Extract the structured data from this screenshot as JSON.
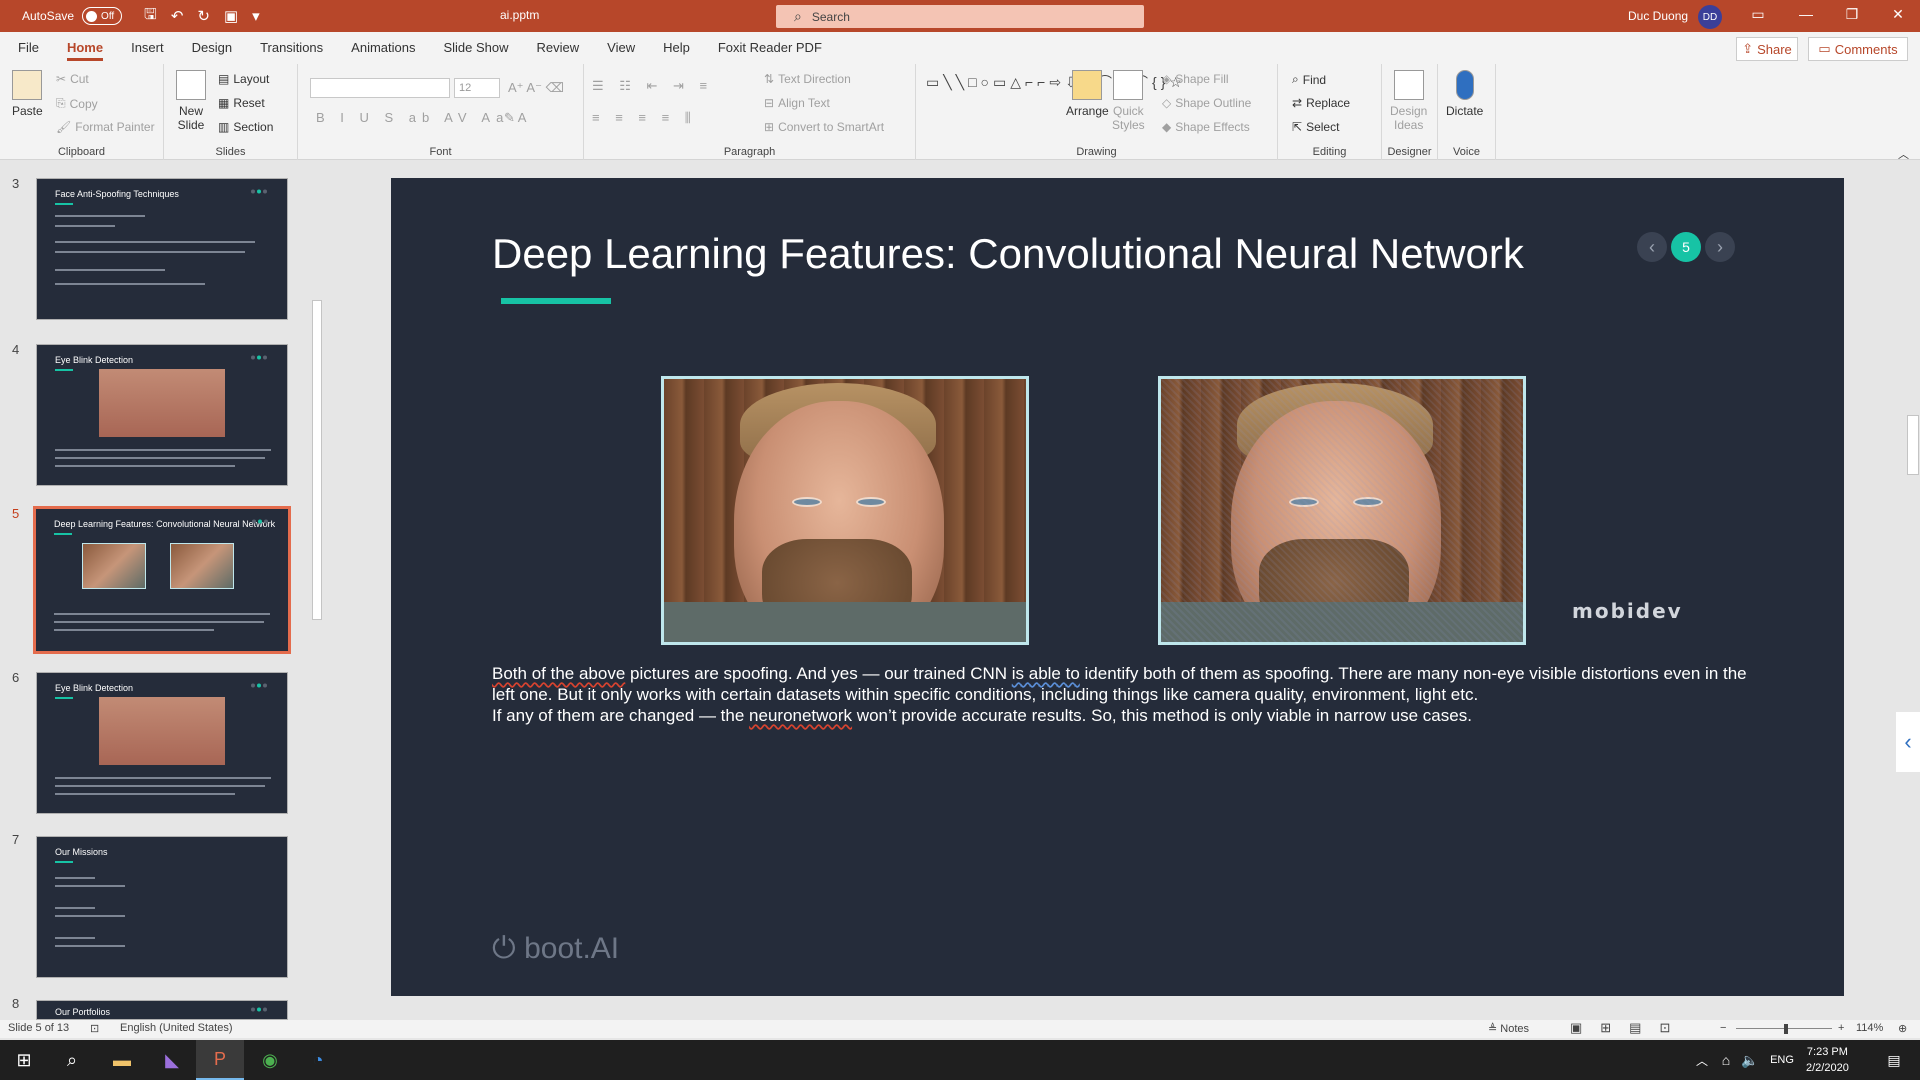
{
  "titlebar": {
    "autosave_label": "AutoSave",
    "autosave_state": "Off",
    "doc_title": "ai.pptm",
    "search_placeholder": "Search",
    "user_name": "Duc Duong",
    "user_initials": "DD"
  },
  "tabs": [
    "File",
    "Home",
    "Insert",
    "Design",
    "Transitions",
    "Animations",
    "Slide Show",
    "Review",
    "View",
    "Help",
    "Foxit Reader PDF"
  ],
  "active_tab": "Home",
  "share_label": "Share",
  "comments_label": "Comments",
  "ribbon": {
    "clipboard": {
      "paste": "Paste",
      "cut": "Cut",
      "copy": "Copy",
      "format_painter": "Format Painter",
      "label": "Clipboard"
    },
    "slides": {
      "new_slide_1": "New",
      "new_slide_2": "Slide",
      "layout": "Layout",
      "reset": "Reset",
      "section": "Section",
      "label": "Slides"
    },
    "font": {
      "size": "12",
      "label": "Font"
    },
    "paragraph": {
      "text_direction": "Text Direction",
      "align_text": "Align Text",
      "convert": "Convert to SmartArt",
      "label": "Paragraph"
    },
    "drawing": {
      "arrange": "Arrange",
      "quick_styles_1": "Quick",
      "quick_styles_2": "Styles",
      "shape_fill": "Shape Fill",
      "shape_outline": "Shape Outline",
      "shape_effects": "Shape Effects",
      "label": "Drawing"
    },
    "editing": {
      "find": "Find",
      "replace": "Replace",
      "select": "Select",
      "label": "Editing"
    },
    "designer": {
      "design_ideas_1": "Design",
      "design_ideas_2": "Ideas",
      "label": "Designer"
    },
    "voice": {
      "dictate": "Dictate",
      "label": "Voice"
    }
  },
  "thumbnails": [
    {
      "num": "3",
      "title": "Face Anti-Spoofing Techniques"
    },
    {
      "num": "4",
      "title": "Eye Blink Detection"
    },
    {
      "num": "5",
      "title": "Deep Learning Features: Convolutional Neural Network"
    },
    {
      "num": "6",
      "title": "Eye Blink Detection"
    },
    {
      "num": "7",
      "title": "Our Missions"
    },
    {
      "num": "8",
      "title": "Our Portfolios"
    }
  ],
  "slide": {
    "title": "Deep Learning Features: Convolutional Neural Network",
    "nav_prev": "‹",
    "nav_current": "5",
    "nav_next": "›",
    "brand_logo": "mobidev",
    "body_p1_a": "Both of the above",
    "body_p1_b": " pictures are spoofing. And yes — our trained CNN ",
    "body_p1_c": "is able to",
    "body_p1_d": " identify both of them as spoofing. There are many non-eye visible distortions even in the left one. But it only works with certain datasets within specific conditions, including things like camera quality, environment, light etc.",
    "body_p2_a": "If any of them are changed — the ",
    "body_p2_b": "neuronetwork",
    "body_p2_c": " won’t provide accurate results. So, this method is only viable in narrow use cases.",
    "footer_logo": "boot.AI"
  },
  "statusbar": {
    "slide_info": "Slide 5 of 13",
    "language": "English (United States)",
    "notes": "Notes",
    "zoom": "114%"
  },
  "taskbar": {
    "lang": "ENG",
    "time": "7:23 PM",
    "date": "2/2/2020"
  }
}
